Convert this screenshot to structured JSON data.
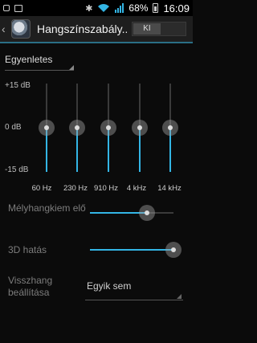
{
  "status_bar": {
    "battery": "68%",
    "time": "16:09",
    "icons": [
      "usb-icon",
      "image-icon",
      "bluetooth-icon",
      "wifi-icon",
      "signal-icon",
      "battery-icon"
    ]
  },
  "action_bar": {
    "title": "Hangszínszabály...",
    "toggle_label": "KI"
  },
  "preset": {
    "selected": "Egyenletes"
  },
  "equalizer": {
    "db_labels": {
      "top": "+15 dB",
      "mid": "0 dB",
      "bottom": "-15 dB"
    },
    "bands": [
      {
        "freq": "60 Hz",
        "level_db": 0
      },
      {
        "freq": "230 Hz",
        "level_db": 0
      },
      {
        "freq": "910 Hz",
        "level_db": 0
      },
      {
        "freq": "4 kHz",
        "level_db": 0
      },
      {
        "freq": "14 kHz",
        "level_db": 0
      }
    ]
  },
  "bass_boost": {
    "label": "Mélyhangkiem elő",
    "level": 0.68
  },
  "virtualizer": {
    "label": "3D hatás",
    "level": 1.0
  },
  "reverb": {
    "label": "Visszhang beállítása",
    "selected": "Egyik sem"
  },
  "colors": {
    "accent": "#33b5e5",
    "background": "#0b0b0b",
    "disabled_text": "#7c7c7c"
  }
}
